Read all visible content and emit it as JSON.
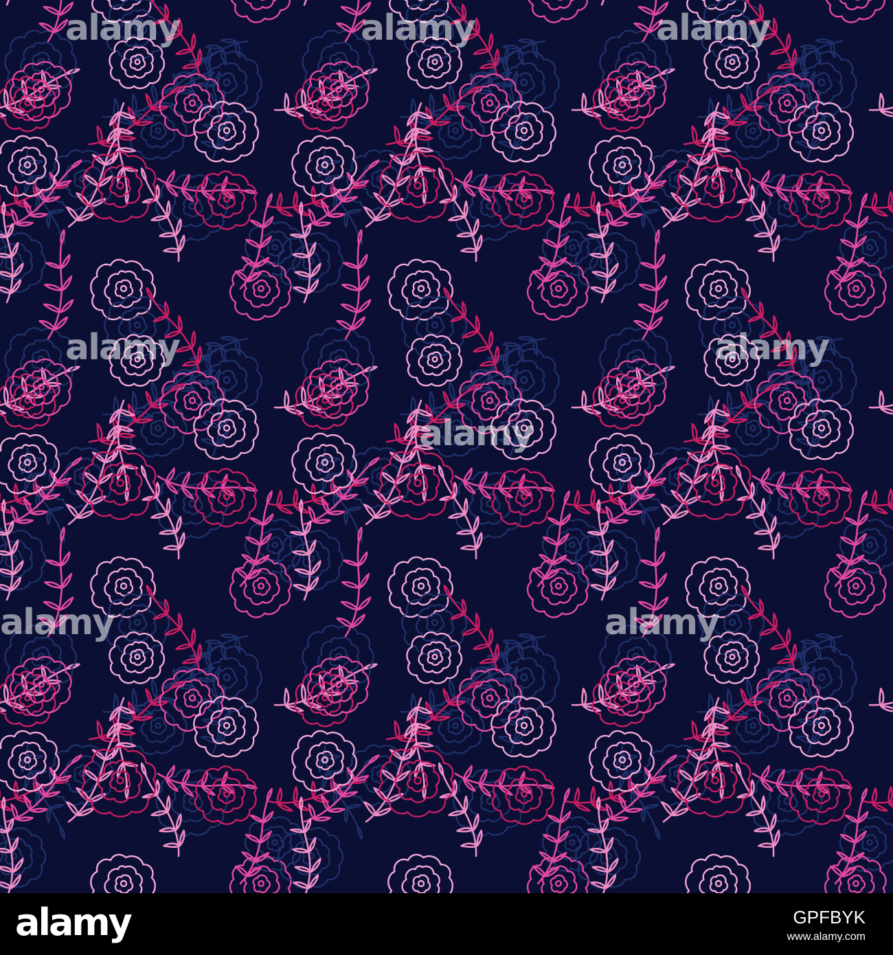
{
  "pattern": {
    "background_color": "#0b0f33",
    "colors": {
      "navy_line": "#22346f",
      "crimson": "#c81e63",
      "magenta": "#e24aa0",
      "pink": "#f08fc7",
      "light_pink": "#f2a9d6"
    },
    "motifs": [
      "flower-outline-icon",
      "leafy-branch-icon"
    ]
  },
  "watermark": {
    "text": "alamy"
  },
  "footer": {
    "logo": "alamy",
    "image_id": "GPFBYK",
    "url": "www.alamy.com"
  }
}
